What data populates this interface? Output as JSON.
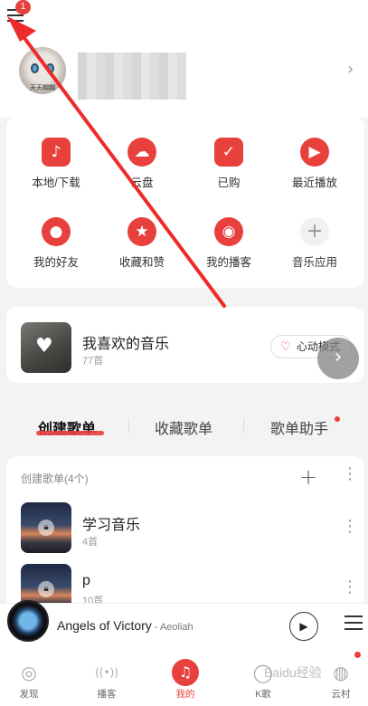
{
  "header": {
    "menu_badge": "1",
    "avatar_caption": "天天糊糊"
  },
  "grid": {
    "items": [
      {
        "label": "本地/下载",
        "icon": "♪"
      },
      {
        "label": "云盘",
        "icon": "☁"
      },
      {
        "label": "已购",
        "icon": "✓"
      },
      {
        "label": "最近播放",
        "icon": "▶"
      },
      {
        "label": "我的好友",
        "icon": "●"
      },
      {
        "label": "收藏和赞",
        "icon": "★"
      },
      {
        "label": "我的播客",
        "icon": "◉"
      },
      {
        "label": "音乐应用",
        "icon": "+"
      }
    ]
  },
  "liked": {
    "title": "我喜欢的音乐",
    "count": "77首",
    "heart_mode": "心动模式"
  },
  "tabs": [
    "创建歌单",
    "收藏歌单",
    "歌单助手"
  ],
  "playlists": {
    "header": "创建歌单(4个)",
    "items": [
      {
        "name": "学习音乐",
        "count": "4首"
      },
      {
        "name": "p",
        "count": "10首"
      }
    ]
  },
  "player": {
    "title": "Angels of Victory",
    "separator": " - ",
    "artist": "Aeoliah"
  },
  "nav": {
    "items": [
      {
        "label": "发现",
        "icon": "◎"
      },
      {
        "label": "播客",
        "icon": "((•))"
      },
      {
        "label": "我的",
        "icon": "♫"
      },
      {
        "label": "K歌",
        "icon": "◯"
      },
      {
        "label": "云村",
        "icon": "◍"
      }
    ]
  },
  "watermark": "Baidu经验",
  "colors": {
    "accent": "#e8403c",
    "annotation_arrow": "#ee2a2a"
  }
}
